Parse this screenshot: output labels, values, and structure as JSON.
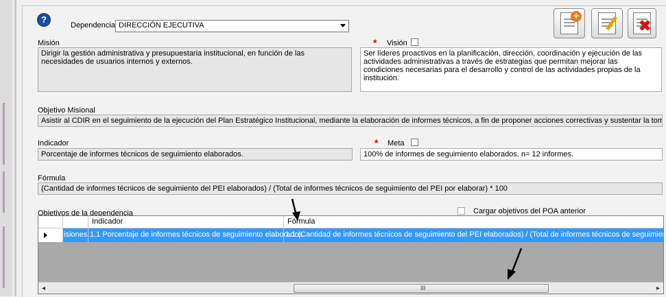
{
  "header": {
    "help_icon": "?",
    "dependencia_label": "Dependencia",
    "dependencia_value": "DIRECCIÓN EJECUTIVA"
  },
  "toolbar": {
    "add_icon": "add-document-icon",
    "edit_icon": "edit-document-icon",
    "delete_icon": "delete-document-icon"
  },
  "mision": {
    "label": "Misión",
    "text": "Dirigir la gestión administrativa y presupuestaria institucional, en función de las necesidades de usuarios internos y externos."
  },
  "vision": {
    "required_mark": "*",
    "label": "Visión",
    "text": "Ser líderes proactivos en la planificación, dirección, coordinación y ejecución de las actividades administrativas a través de estrategias que permitan mejorar las condiciones necesarias para el desarrollo y control de las actividades propias de la institución."
  },
  "objetivo": {
    "label": "Objetivo Misional",
    "text": "Asistir al CDIR en el seguimiento de la ejecución del Plan Estratégico Institucional, mediante la elaboración de informes técnicos, a fin de proponer acciones correctivas y sustentar la toma de decisiones."
  },
  "indicador": {
    "label": "Indicador",
    "text": "Porcentaje de informes técnicos de seguimiento elaborados."
  },
  "meta": {
    "required_mark": "*",
    "label": "Meta",
    "text": "100% de informes de seguimiento elaborados. n= 12 informes."
  },
  "formula": {
    "label": "Fórmula",
    "text": "(Cantidad de informes técnicos de seguimiento del PEI elaborados) / (Total de informes técnicos de seguimiento del PEI por elaborar) * 100"
  },
  "objetivos_dep": {
    "label": "Objetivos de la dependencia",
    "cargar_label": "Cargar objetivos del POA anterior",
    "columns": [
      "Indicador",
      "Fórmula"
    ],
    "row": {
      "c0": "isiones.",
      "c1": "1.1  Porcentaje de informes técnicos de seguimiento elaborados.",
      "c2": "1.1  (Cantidad de informes técnicos de seguimiento del PEI elaborados) / (Total de informes técnicos de seguimiento del PEI por"
    },
    "scroll_grip": "III",
    "scroll_left": "◂",
    "scroll_right": "▸"
  },
  "colors": {
    "selection": "#3399ff",
    "required": "#d40000",
    "grid_background": "#a9a9a9"
  }
}
